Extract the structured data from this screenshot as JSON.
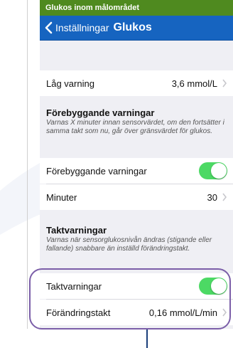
{
  "status_bar": {
    "text": "Glukos inom målområdet",
    "color": "#4f8a1f"
  },
  "nav": {
    "back_icon": "chevron-left-icon",
    "back_label": "Inställningar",
    "title": "Glukos",
    "color": "#1664c0"
  },
  "low_alert": {
    "label": "Låg varning",
    "value": "3,6 mmol/L"
  },
  "predictive": {
    "title": "Förebyggande varningar",
    "description": "Varnas X minuter innan sensorvärdet, om den fortsätter i samma takt som nu, går över gränsvärdet för glukos.",
    "toggle_label": "Förebyggande varningar",
    "toggle_on": true,
    "minutes_label": "Minuter",
    "minutes_value": "30"
  },
  "rate": {
    "title": "Taktvarningar",
    "description": "Varnas när sensorglukosnivån ändras (stigande eller fallande) snabbare än inställd förändringstakt.",
    "toggle_label": "Taktvarningar",
    "toggle_on": true,
    "rate_label": "Förändringstakt",
    "rate_value": "0,16 mmol/L/min"
  },
  "colors": {
    "toggle_on": "#4cd964",
    "highlight_border": "#7b5ea8",
    "pointer": "#1a3f7a"
  }
}
